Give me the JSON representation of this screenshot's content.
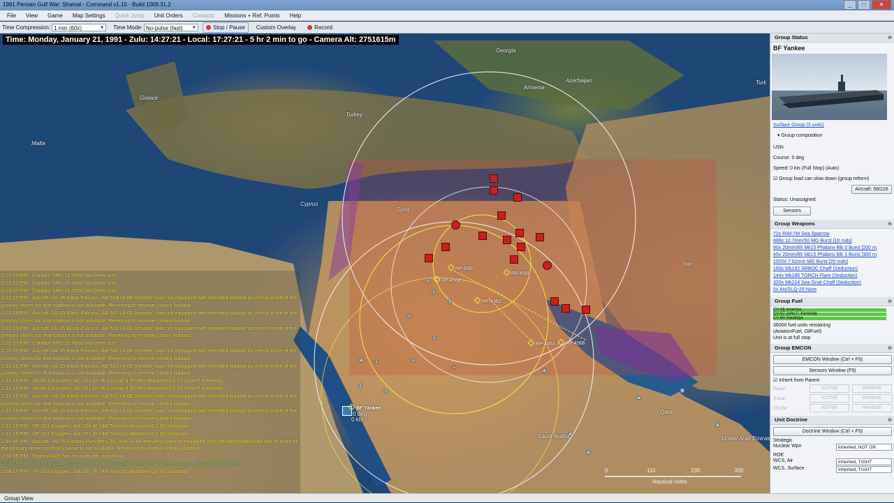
{
  "window": {
    "title": "1991 Persian Gulf War: Shamal - Command v1.15 - Build 1009.31.2",
    "controls": [
      "_",
      "□",
      "✕"
    ]
  },
  "menu": [
    "File",
    "View",
    "Game",
    "Map Settings",
    "Quick Jump",
    "Unit Orders",
    "Contacts",
    "Missions + Ref. Points",
    "Help"
  ],
  "toolbar": {
    "time_compression_label": "Time Compression:",
    "time_compression_value": "1 min (60x)",
    "time_mode_label": "Time Mode:",
    "time_mode_value": "No-pulse (fast)",
    "stop_pause": "Stop / Pause",
    "custom_overlay": "Custom Overlay",
    "record": "Record"
  },
  "map": {
    "time_text": "Time: Monday, January 21, 1991 - Zulu: 14:27:21 - Local: 17:27:21 - 5 hr 2 min to go - Camera Alt: 2751615m",
    "labels": {
      "georgia": "Georgia",
      "armenia": "Armenia",
      "azerbaijan": "Azerbaijan",
      "turkey": "Turkey",
      "greece": "Greece",
      "malta": "Malta",
      "cyprus": "Cyprus",
      "syria": "Syria",
      "iran": "Iran",
      "qatar": "Qatar",
      "saudi": "Saudi Arabia",
      "uae": "United Arab Emirates",
      "turk2": "Turk"
    },
    "ref_points": {
      "rp4557": "RP-4557",
      "rp4556": "RP-4556",
      "rp4550": "RP-4550",
      "rp4362": "RP-4362",
      "rp4563": "RP-4563",
      "rp4566": "RP-4566"
    },
    "unit_label": "BF Yankee",
    "unit_sub1": "0 deg",
    "unit_sub2": "0 kts",
    "scale_labels": {
      "s0": "0",
      "s110": "110",
      "s230": "230",
      "s300": "300",
      "unit": "Nautical miles"
    }
  },
  "log": [
    {
      "text": "2:25:59 PM - Contact: MIG-21 #480 has been lost.",
      "color": "yellow"
    },
    {
      "text": "2:25:52 PM - Contact: MIG-21 #480 has been lost.",
      "color": "yellow"
    },
    {
      "text": "2:23:47 PM - Contact: MIG-21 #500 has been lost.",
      "color": "yellow"
    },
    {
      "text": "2:22:59 PM - Aircraft: VA-35 Black Falcons, AB-504 (A-6E Intruder) was not equipped with intended loadout as one or more of the",
      "color": "yellow"
    },
    {
      "text": "primary stores for that loadout is not available. Reverting to reserve (clean) loadout",
      "color": "yellow"
    },
    {
      "text": "2:22:59 PM - Aircraft: VA-35 Black Falcons, AB-502 (A-6E Intruder) was not equipped with intended loadout as one or more of the",
      "color": "yellow"
    },
    {
      "text": "primary stores for that loadout is not available. Reverting to reserve (clean) loadout",
      "color": "yellow"
    },
    {
      "text": "2:22:59 PM - Aircraft: VA-35 Black Falcons, AB-503 (A-6E Intruder) was not equipped with intended loadout as one or more of the",
      "color": "yellow"
    },
    {
      "text": "primary stores for that loadout is not available. Reverting to reserve (clean) loadout",
      "color": "yellow"
    },
    {
      "text": "2:22:37 PM - Contact: MIG-21 #501 has been lost.",
      "color": "yellow"
    },
    {
      "text": "2:20:20 PM - Aircraft: VA-35 Black Falcons, AB-502 (A-6E Intruder) was not equipped with intended loadout as one or more of the",
      "color": "yellow"
    },
    {
      "text": "primary stores for that loadout is not available. Reverting to reserve (clean) loadout",
      "color": "yellow"
    },
    {
      "text": "2:18:15 PM - Aircraft: VA-35 Black Falcons, AB-503 (A-6E Intruder) was not equipped with intended loadout as one or more of the",
      "color": "yellow"
    },
    {
      "text": "primary stores for that loadout is not available. Reverting to reserve (clean) loadout",
      "color": "yellow"
    },
    {
      "text": "2:16:19 PM - VA-46 Clansmen, AC-302 (A-7E Corsair II [FLIR]) departed CV 67 John F. Kennedy.",
      "color": "yellow"
    },
    {
      "text": "2:16:19 PM - VA-46 Clansmen, AC-301 (A-7E Corsair II [FLIR]) departed CV 67 John F. Kennedy.",
      "color": "yellow"
    },
    {
      "text": "2:15:15 PM - Aircraft: VA-35 Black Falcons, AB-502 (A-6E Intruder) was not equipped with intended loadout as one or more of the",
      "color": "yellow"
    },
    {
      "text": "primary stores for that loadout is not available. Reverting to reserve (clean) loadout",
      "color": "yellow"
    },
    {
      "text": "2:12:09 PM - Aircraft: VA-35 Black Falcons, AB-501 (A-6E Intruder) was not equipped with intended loadout as one or more of the",
      "color": "yellow"
    },
    {
      "text": "primary stores for that loadout is not available. Reverting to reserve (clean) loadout",
      "color": "yellow"
    },
    {
      "text": "2:12:19 PM - VF-103 Sluggers, AA-204 (F-14B Tomcat) departed CV 60 Saratoga.",
      "color": "yellow"
    },
    {
      "text": "2:12:19 PM - VF-103 Sluggers, AA-201 (F-14B Tomcat) departed CV 60 Saratoga.",
      "color": "yellow"
    },
    {
      "text": "2:10:45 PM - Aircraft: VA-75 Sunday Punchers, AC-506 (A-6E Intruder) was not equipped with intended loadout as one or more of",
      "color": "yellow"
    },
    {
      "text": "the primary stores for that loadout is not available. Reverting to reserve (clean) loadout",
      "color": "yellow"
    },
    {
      "text": "2:08:59 PM - Flight #6369 has no units left, dissolving.",
      "color": "yellow"
    },
    {
      "text": "2:08:19 PM - VF-103 Sluggers, AA-207 (F-14B Tomcat) is ready at CV 60 Saratoga, moving to flight deck.",
      "color": "green"
    },
    {
      "text": "2:08:19 PM - VF-103 Sluggers, AA-205 (F-14B Tomcat) departed CV 60 Saratoga.",
      "color": "yellow"
    }
  ],
  "panel": {
    "group_status": "Group Status",
    "group_name": "BF Yankee",
    "surface_group_link": "Surface Group (3 units)",
    "group_composition": "Group composition",
    "side": "USN",
    "course": "Course: 0 deg",
    "speed": "Speed: 0 kts (Full Stop)   (Auto)",
    "group_lead_opt": "Group lead can slow down (group reform)",
    "aircraft_btn": "Aircraft: 56/226",
    "status": "Status: Unassigned",
    "sensors_btn": "Sensors",
    "group_weapons": "Group Weapons",
    "weapons": [
      "72x RIM-7M Sea Sparrow",
      "888x 12.7mm/50 MG Burst [10 rnds]",
      "90x 20mm/85 Mk15 Phalanx Blk 0 Burst [200 rn",
      "45x 20mm/85 Mk15 Phalanx Blk 1 Burst [300 rn",
      "1920x 7.62mm MG Burst [20 rnds]",
      "160x Mk182 SRBOC Chaff (Seduction)",
      "144x Mk186 TORCH Flare (Seduction)",
      "320x Mk214 Sea Gnat Chaff (Seduction)",
      "5x AN/SLQ-25 Nixie"
    ],
    "group_fuel": "Group Fuel",
    "fuel_units": [
      {
        "name": "CV 66 America",
        "level": 0.95
      },
      {
        "name": "CV 67 John F. Kennedy",
        "level": 0.95
      },
      {
        "name": "CV 60 Saratoga",
        "level": 0.95
      }
    ],
    "fuel_remaining": "36000 fuel units remaining",
    "fuel_type": "(AviationFuel, OilFuel)",
    "fuel_status": "Unit is at full stop",
    "group_emcon": "Group EMCON",
    "emcon_window_btn": "EMCON Window (Ctrl + F9)",
    "sensors_window_btn": "Sensors Window (F9)",
    "inherit": "Inherit from Parent",
    "emcon_rows": [
      {
        "label": "Radar",
        "active": "ACTIVE",
        "passive": "PASSIVE"
      },
      {
        "label": "Sonar",
        "active": "ACTIVE",
        "passive": "PASSIVE"
      },
      {
        "label": "OECM",
        "active": "ACTIVE",
        "passive": "PASSIVE"
      }
    ],
    "unit_doctrine": "Unit Doctrine",
    "doctrine_btn": "Doctrine Window (Ctrl + F9)",
    "strategic": "Strategic",
    "nuclear": "Nuclear Wpn",
    "nuclear_val": "Inherited, NOT GR",
    "roe": "ROE",
    "wcs_air": "WCS, Air",
    "wcs_air_val": "Inherited, TIGHT",
    "wcs_surface": "WCS, Surface",
    "wcs_surface_val": "Inherited, TIGHT"
  },
  "statusbar": "Group View",
  "colors": {
    "unit_hostile": "#c8201c",
    "unit_friendly": "#8fd8f0",
    "range_ring": "#f6e540",
    "fuel_green": "#5fc44c"
  }
}
